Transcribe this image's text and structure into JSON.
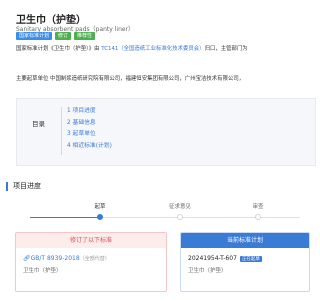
{
  "header": {
    "title": "卫生巾（护垫）",
    "subtitle": "Sanitary absorbent pads（panty liner）",
    "tags": [
      {
        "label": "国家标准计划",
        "color": "#3a8ee6"
      },
      {
        "label": "修订",
        "color": "#4caf50"
      },
      {
        "label": "推荐性",
        "color": "#4caf50"
      }
    ]
  },
  "description": {
    "line1_prefix": "国家标准计划《卫生巾（护垫）》由 ",
    "line1_link": "TC141（全国造纸工业标准化技术委员会）",
    "line1_suffix": "归口，主管部门为",
    "line2": "主要起草单位 中国制浆造纸研究院有限公司，福建恒安集团有限公司，广州宝洁技术有限公司，"
  },
  "toc": {
    "label": "目录",
    "items": [
      "1 项目进度",
      "2 基础信息",
      "3 起草单位",
      "4 相近标准(计划)"
    ]
  },
  "progress": {
    "section_title": "项目进度",
    "steps": [
      "起草",
      "征求意见",
      "审查"
    ]
  },
  "cards": {
    "left": {
      "header": "修订了以下标准",
      "code": "GB/T 8939-2018",
      "code_note": "（全部代替）",
      "name": "卫生巾（护垫）"
    },
    "right": {
      "header": "当前标准计划",
      "code": "20241954-T-607",
      "badge": "正在起草",
      "name": "卫生巾（护垫）"
    }
  }
}
